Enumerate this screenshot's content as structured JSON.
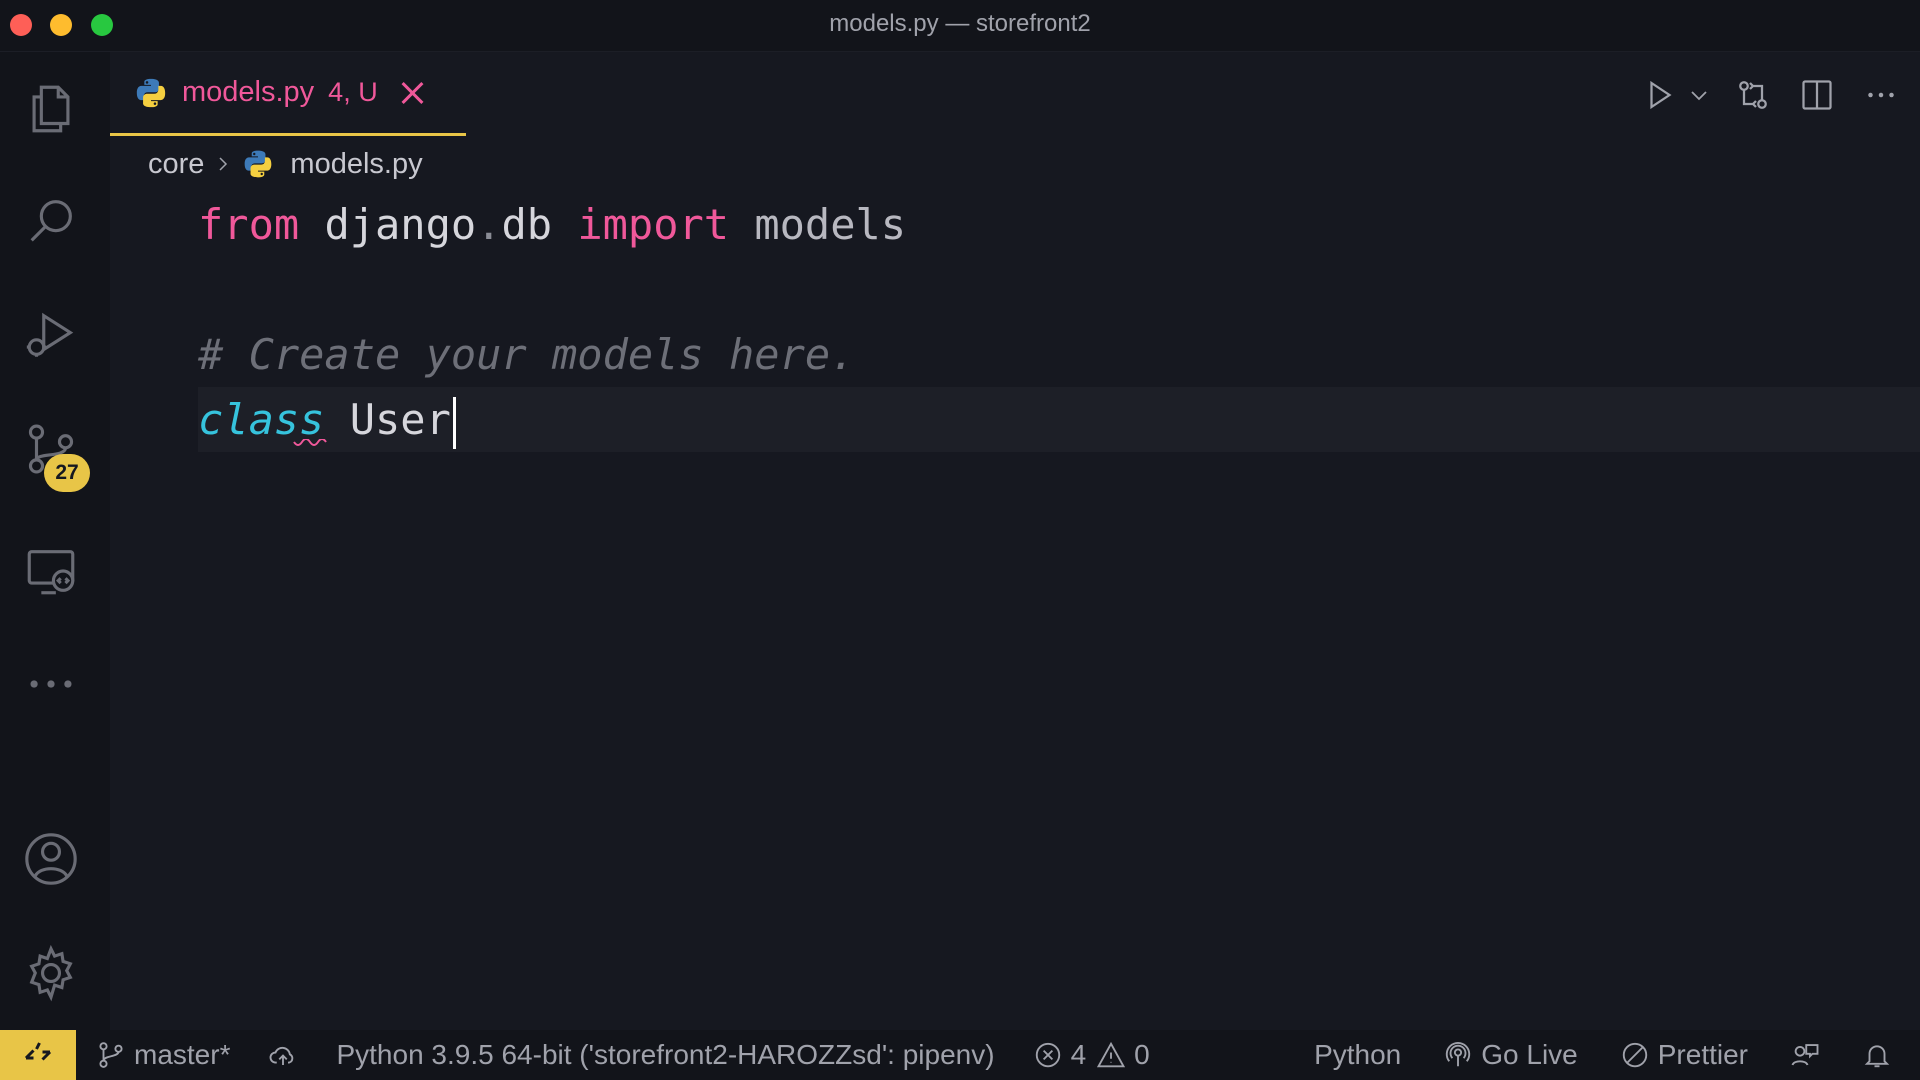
{
  "window": {
    "title": "models.py — storefront2"
  },
  "activity_bar": {
    "items": [
      {
        "icon": "files-icon"
      },
      {
        "icon": "search-icon"
      },
      {
        "icon": "run-debug-icon"
      },
      {
        "icon": "source-control-icon",
        "badge": "27"
      },
      {
        "icon": "remote-explorer-icon"
      },
      {
        "icon": "more-icon"
      }
    ],
    "bottom": [
      {
        "icon": "account-icon"
      },
      {
        "icon": "gear-icon"
      }
    ]
  },
  "tab": {
    "filename": "models.py",
    "status": "4, U"
  },
  "breadcrumb": {
    "folder": "core",
    "file": "models.py"
  },
  "code": {
    "line1": {
      "from": "from",
      "module": "django",
      "dot": ".",
      "sub": "db",
      "import": "import",
      "name": "models"
    },
    "line3": {
      "comment": "# Create your models here."
    },
    "line4": {
      "keyword": "class",
      "name": "User"
    }
  },
  "status_bar": {
    "branch": "master*",
    "interpreter": "Python 3.9.5 64-bit ('storefront2-HAROZZsd': pipenv)",
    "errors": "4",
    "warnings": "0",
    "language": "Python",
    "go_live": "Go Live",
    "prettier": "Prettier"
  },
  "colors": {
    "accent": "#e8c547",
    "keyword": "#f0589a",
    "class_keyword": "#36c3dd",
    "comment": "#6d6f78"
  }
}
